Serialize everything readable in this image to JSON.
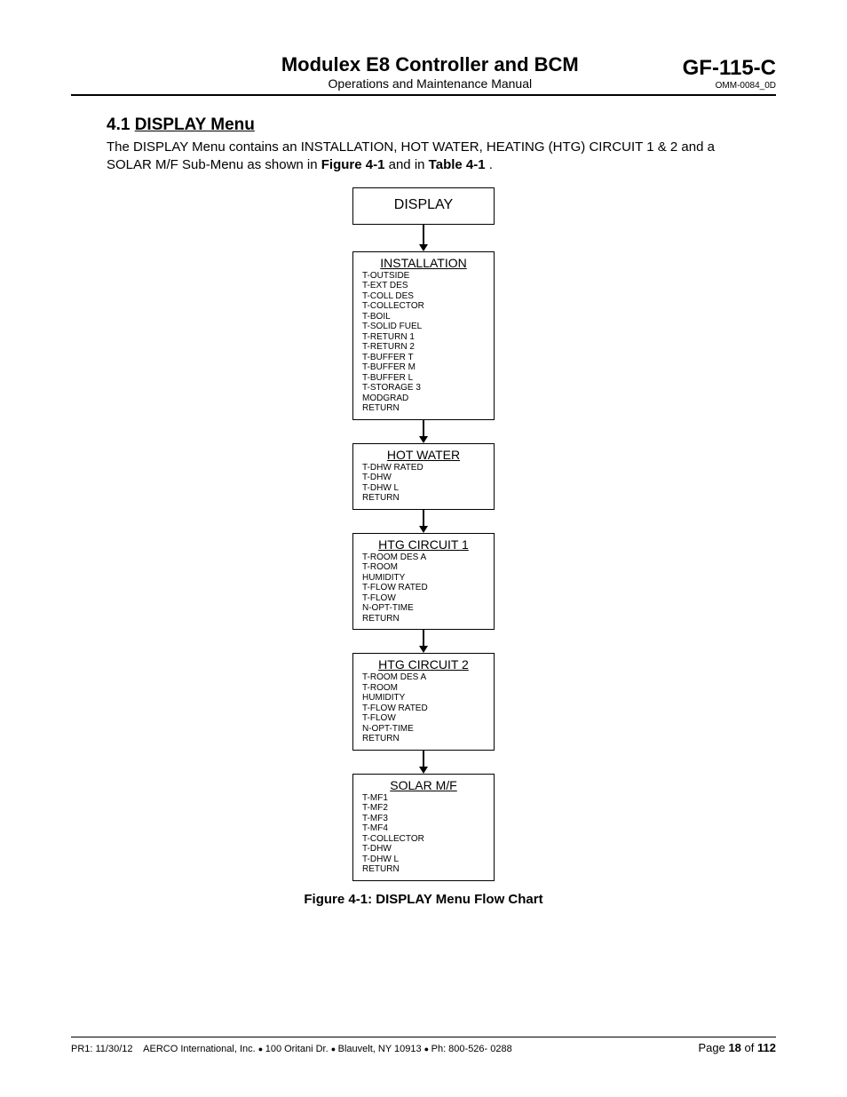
{
  "header": {
    "title": "Modulex E8 Controller and BCM",
    "subtitle": "Operations and Maintenance Manual",
    "doc_code": "GF-115-C",
    "doc_rev": "OMM-0084_0D"
  },
  "section": {
    "number": "4.1",
    "title": "DISPLAY Menu",
    "body_part1": "The DISPLAY Menu contains an INSTALLATION, HOT WATER, HEATING (HTG) CIRCUIT 1 & 2 and a SOLAR M/F Sub-Menu as shown in ",
    "body_bold1": "Figure 4-1",
    "body_mid": " and in ",
    "body_bold2": "Table 4-1",
    "body_end": "."
  },
  "diagram": {
    "top": "DISPLAY",
    "boxes": [
      {
        "title": "INSTALLATION",
        "items": [
          "T-OUTSIDE",
          "T-EXT DES",
          "T-COLL DES",
          "T-COLLECTOR",
          "T-BOIL",
          "T-SOLID FUEL",
          "T-RETURN 1",
          "T-RETURN 2",
          "T-BUFFER T",
          "T-BUFFER M",
          "T-BUFFER L",
          "T-STORAGE 3",
          "MODGRAD",
          "RETURN"
        ]
      },
      {
        "title": "HOT WATER",
        "items": [
          "T-DHW RATED",
          "T-DHW",
          "T-DHW L",
          "RETURN"
        ]
      },
      {
        "title": "HTG CIRCUIT 1",
        "items": [
          "T-ROOM DES A",
          "T-ROOM",
          "HUMIDITY",
          "T-FLOW RATED",
          "T-FLOW",
          "N-OPT-TIME",
          "RETURN"
        ]
      },
      {
        "title": "HTG CIRCUIT 2",
        "items": [
          "T-ROOM DES A",
          "T-ROOM",
          "HUMIDITY",
          "T-FLOW RATED",
          "T-FLOW",
          "N-OPT-TIME",
          "RETURN"
        ]
      },
      {
        "title": "SOLAR M/F",
        "items": [
          "T-MF1",
          "T-MF2",
          "T-MF3",
          "T-MF4",
          "T-COLLECTOR",
          "T-DHW",
          "T-DHW L",
          "RETURN"
        ]
      }
    ],
    "caption": "Figure 4-1:  DISPLAY Menu Flow Chart"
  },
  "footer": {
    "pr": "PR1: 11/30/12",
    "company": "AERCO International, Inc.",
    "addr": "100 Oritani Dr.",
    "city": "Blauvelt, NY 10913",
    "phone": "Ph: 800-526- 0288",
    "page_label": "Page",
    "page_num": "18",
    "page_of": "of",
    "page_total": "112"
  }
}
